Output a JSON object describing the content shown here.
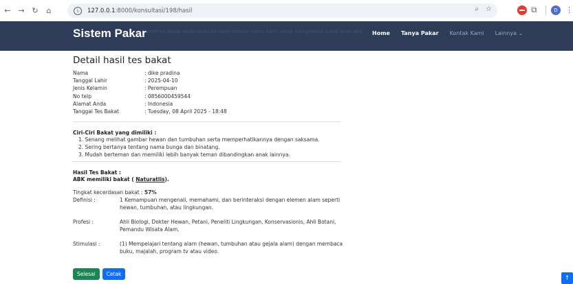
{
  "browser": {
    "url_host": "127.0.0.1",
    "url_path": ":8000/konsultasi/198/hasil",
    "profile_initial": "D"
  },
  "navbar": {
    "brand": "Sistem Pakar",
    "ghost_text": "Sistem ini dapat anda akses ke kami melalui menu kami untuk mengetahui bakat anak anda dan ketahui tingkat kecerdasan bakat anak (CMP)",
    "menu": [
      "Home",
      "Tanya Pakar",
      "Kontak Kami",
      "Lainnya"
    ]
  },
  "detail": {
    "title": "Detail hasil tes bakat",
    "fields": [
      {
        "label": "Nama",
        "value": ": dike pradina"
      },
      {
        "label": "Tanggal Lahir",
        "value": ": 2025-04-10"
      },
      {
        "label": "Jenis Kelamin",
        "value": ": Perempuan"
      },
      {
        "label": "No telp",
        "value": ": 0856000459544"
      },
      {
        "label": "Alamat Anda",
        "value": ": Indonesia"
      },
      {
        "label": "Tanggal Tes Bakat",
        "value": ": Tuesday, 08 April 2025 - 18:48"
      }
    ]
  },
  "traits": {
    "heading": "Ciri-Ciri Bakat yang dimiliki :",
    "items": [
      "1. Senang melihat gambar hewan dan tumbuhan serta memperhatikannya dengan saksama.",
      "2. Sering bertanya tentang nama bunga dan binatang.",
      "3. Mudah berteman dan memiliki lebih banyak teman dibandingkan anak lainnya."
    ]
  },
  "result": {
    "heading": "Hasil Tes Bakat :",
    "line_prefix": "ABK memiliki bakat ( ",
    "talent": "Naturatlis",
    "line_suffix": ").",
    "level_label": "Tingkat kecerdasan bakat : ",
    "level_value": "57%",
    "rows": [
      {
        "label": "Definisi :",
        "value": "1 Kemampuan mengenali, memahami, dan berinteraksi dengan elemen alam seperti hewan, tumbuhan, atau lingkungan."
      },
      {
        "label": "Profesi :",
        "value": "Ahli Biologi, Dokter Hewan, Petani, Peneliti Lingkungan, Konservasionis, Ahli Botani, Pemandu Wisata Alam."
      },
      {
        "label": "Stimulasi :",
        "value": "(1) Mempelajari tentang alam (hewan, tumbuhan atau gejala alam) dengan membaca buku, majalah, program tv atau video."
      }
    ]
  },
  "buttons": {
    "done": "Selesai",
    "print": "Cetak"
  },
  "colors": {
    "navbar": "#2e3c58",
    "done_button": "#198754",
    "print_button": "#0d6efd"
  }
}
